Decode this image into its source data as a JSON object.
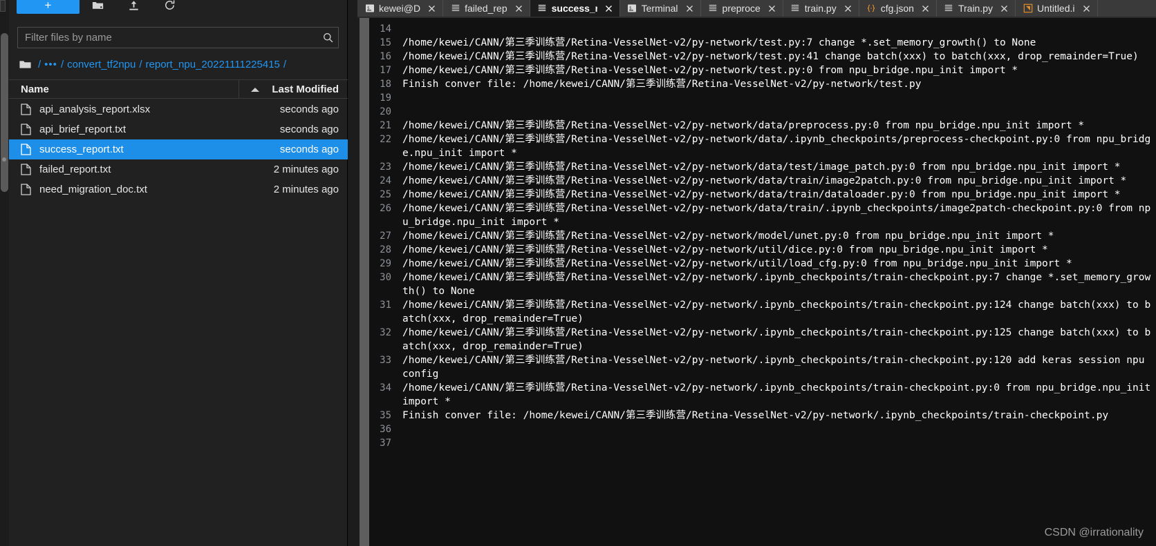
{
  "file_browser": {
    "toolbar": {
      "new_label": "+",
      "icons": [
        "new-folder-icon",
        "upload-icon",
        "refresh-icon"
      ]
    },
    "filter": {
      "placeholder": "Filter files by name",
      "value": ""
    },
    "breadcrumb": {
      "root_icon": "folder-icon",
      "ellipsis": "•••",
      "separator": "/",
      "segments": [
        "convert_tf2npu",
        "report_npu_20221111225415"
      ]
    },
    "columns": {
      "name": "Name",
      "last_modified": "Last Modified",
      "sort": "ascending"
    },
    "files": [
      {
        "name": "api_analysis_report.xlsx",
        "modified": "seconds ago",
        "selected": false
      },
      {
        "name": "api_brief_report.txt",
        "modified": "seconds ago",
        "selected": false
      },
      {
        "name": "success_report.txt",
        "modified": "seconds ago",
        "selected": true
      },
      {
        "name": "failed_report.txt",
        "modified": "2 minutes ago",
        "selected": false
      },
      {
        "name": "need_migration_doc.txt",
        "modified": "2 minutes ago",
        "selected": false
      }
    ]
  },
  "editor": {
    "tabs": [
      {
        "label": "kewei@D",
        "icon": "terminal-icon",
        "active": false,
        "width_class": "w-keweiD"
      },
      {
        "label": "failed_rep",
        "icon": "text-file-icon",
        "active": false,
        "width_class": "w-failed"
      },
      {
        "label": "success_r",
        "icon": "text-file-icon",
        "active": true,
        "width_class": "w-success"
      },
      {
        "label": "Terminal",
        "icon": "terminal-icon",
        "active": false,
        "width_class": ""
      },
      {
        "label": "preproce",
        "icon": "text-file-icon",
        "active": false,
        "width_class": "w-preproc"
      },
      {
        "label": "train.py",
        "icon": "text-file-icon",
        "active": false,
        "width_class": ""
      },
      {
        "label": "cfg.json",
        "icon": "json-icon",
        "active": false,
        "width_class": ""
      },
      {
        "label": "Train.py",
        "icon": "text-file-icon",
        "active": false,
        "width_class": ""
      },
      {
        "label": "Untitled.i",
        "icon": "notebook-icon",
        "active": false,
        "width_class": "w-untitled"
      }
    ],
    "lines": [
      {
        "no": "14",
        "text": ""
      },
      {
        "no": "15",
        "text": "/home/kewei/CANN/第三季训练营/Retina-VesselNet-v2/py-network/test.py:7 change *.set_memory_growth() to None"
      },
      {
        "no": "16",
        "text": "/home/kewei/CANN/第三季训练营/Retina-VesselNet-v2/py-network/test.py:41 change batch(xxx) to batch(xxx, drop_remainder=True)"
      },
      {
        "no": "17",
        "text": "/home/kewei/CANN/第三季训练营/Retina-VesselNet-v2/py-network/test.py:0 from npu_bridge.npu_init import *"
      },
      {
        "no": "18",
        "text": "Finish conver file: /home/kewei/CANN/第三季训练营/Retina-VesselNet-v2/py-network/test.py"
      },
      {
        "no": "19",
        "text": ""
      },
      {
        "no": "20",
        "text": ""
      },
      {
        "no": "21",
        "text": "/home/kewei/CANN/第三季训练营/Retina-VesselNet-v2/py-network/data/preprocess.py:0 from npu_bridge.npu_init import *"
      },
      {
        "no": "22",
        "text": "/home/kewei/CANN/第三季训练营/Retina-VesselNet-v2/py-network/data/.ipynb_checkpoints/preprocess-checkpoint.py:0 from npu_bridge.npu_init import *"
      },
      {
        "no": "23",
        "text": "/home/kewei/CANN/第三季训练营/Retina-VesselNet-v2/py-network/data/test/image_patch.py:0 from npu_bridge.npu_init import *"
      },
      {
        "no": "24",
        "text": "/home/kewei/CANN/第三季训练营/Retina-VesselNet-v2/py-network/data/train/image2patch.py:0 from npu_bridge.npu_init import *"
      },
      {
        "no": "25",
        "text": "/home/kewei/CANN/第三季训练营/Retina-VesselNet-v2/py-network/data/train/dataloader.py:0 from npu_bridge.npu_init import *"
      },
      {
        "no": "26",
        "text": "/home/kewei/CANN/第三季训练营/Retina-VesselNet-v2/py-network/data/train/.ipynb_checkpoints/image2patch-checkpoint.py:0 from npu_bridge.npu_init import *"
      },
      {
        "no": "27",
        "text": "/home/kewei/CANN/第三季训练营/Retina-VesselNet-v2/py-network/model/unet.py:0 from npu_bridge.npu_init import *"
      },
      {
        "no": "28",
        "text": "/home/kewei/CANN/第三季训练营/Retina-VesselNet-v2/py-network/util/dice.py:0 from npu_bridge.npu_init import *"
      },
      {
        "no": "29",
        "text": "/home/kewei/CANN/第三季训练营/Retina-VesselNet-v2/py-network/util/load_cfg.py:0 from npu_bridge.npu_init import *"
      },
      {
        "no": "30",
        "text": "/home/kewei/CANN/第三季训练营/Retina-VesselNet-v2/py-network/.ipynb_checkpoints/train-checkpoint.py:7 change *.set_memory_growth() to None"
      },
      {
        "no": "31",
        "text": "/home/kewei/CANN/第三季训练营/Retina-VesselNet-v2/py-network/.ipynb_checkpoints/train-checkpoint.py:124 change batch(xxx) to batch(xxx, drop_remainder=True)"
      },
      {
        "no": "32",
        "text": "/home/kewei/CANN/第三季训练营/Retina-VesselNet-v2/py-network/.ipynb_checkpoints/train-checkpoint.py:125 change batch(xxx) to batch(xxx, drop_remainder=True)"
      },
      {
        "no": "33",
        "text": "/home/kewei/CANN/第三季训练营/Retina-VesselNet-v2/py-network/.ipynb_checkpoints/train-checkpoint.py:120 add keras session npu config"
      },
      {
        "no": "34",
        "text": "/home/kewei/CANN/第三季训练营/Retina-VesselNet-v2/py-network/.ipynb_checkpoints/train-checkpoint.py:0 from npu_bridge.npu_init import *"
      },
      {
        "no": "35",
        "text": "Finish conver file: /home/kewei/CANN/第三季训练营/Retina-VesselNet-v2/py-network/.ipynb_checkpoints/train-checkpoint.py"
      },
      {
        "no": "36",
        "text": ""
      },
      {
        "no": "37",
        "text": ""
      }
    ],
    "watermark": "CSDN @irrationality"
  },
  "colors": {
    "accent": "#2196f3",
    "selection": "#1e8fe8",
    "panel_bg": "#212121",
    "editor_bg": "#111111",
    "tabbar_bg": "#3a3a3a",
    "json_icon": "#e08b2a"
  }
}
